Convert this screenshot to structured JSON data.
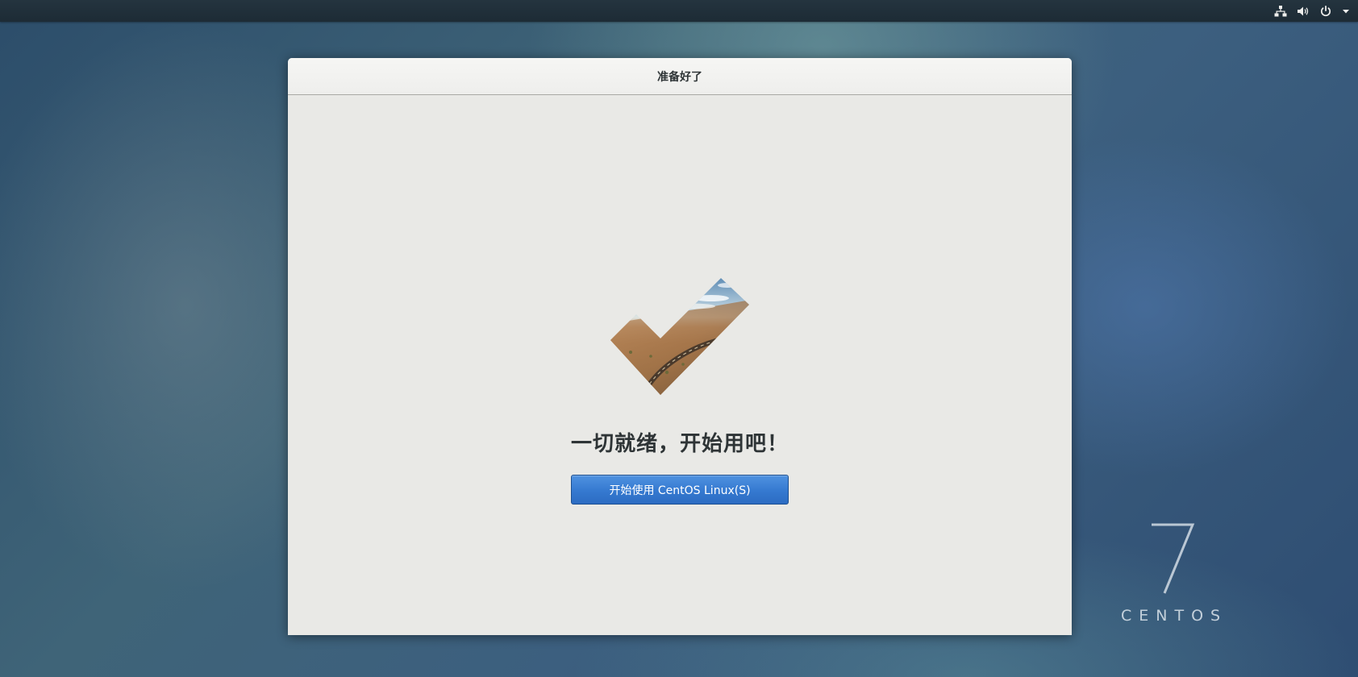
{
  "topbar": {
    "icons": [
      "network-icon",
      "volume-icon",
      "power-icon",
      "chevron-down-icon"
    ]
  },
  "dialog": {
    "title": "准备好了",
    "headline": "一切就绪，开始用吧！",
    "start_button_label": "开始使用 CentOS Linux(S)"
  },
  "desktop": {
    "brand_number": "7",
    "brand_name": "CENTOS"
  },
  "colors": {
    "accent": "#3579d0",
    "dialog_bg": "#e9e9e6",
    "topbar_bg": "#1d2b35"
  }
}
